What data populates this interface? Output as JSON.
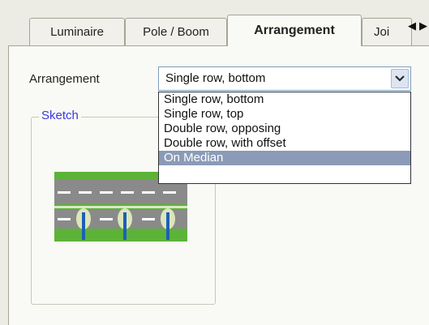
{
  "tabs": [
    {
      "label": "Luminaire",
      "active": false
    },
    {
      "label": "Pole / Boom",
      "active": false
    },
    {
      "label": "Arrangement",
      "active": true
    },
    {
      "label": "Joi",
      "active": false
    }
  ],
  "tab_scroll": {
    "left": "◀",
    "right": "▶"
  },
  "arrangement": {
    "label": "Arrangement",
    "selected": "Single row, bottom",
    "options": [
      "Single row, bottom",
      "Single row, top",
      "Double row, opposing",
      "Double row, with offset",
      "On Median"
    ],
    "highlighted_option": "On Median"
  },
  "sketch": {
    "title": "Sketch"
  },
  "colors": {
    "accent": "#3a3adb",
    "highlight": "#8b9bb7",
    "grass": "#5cb338",
    "road": "#8a8a8a",
    "pole": "#1e5fb5"
  }
}
